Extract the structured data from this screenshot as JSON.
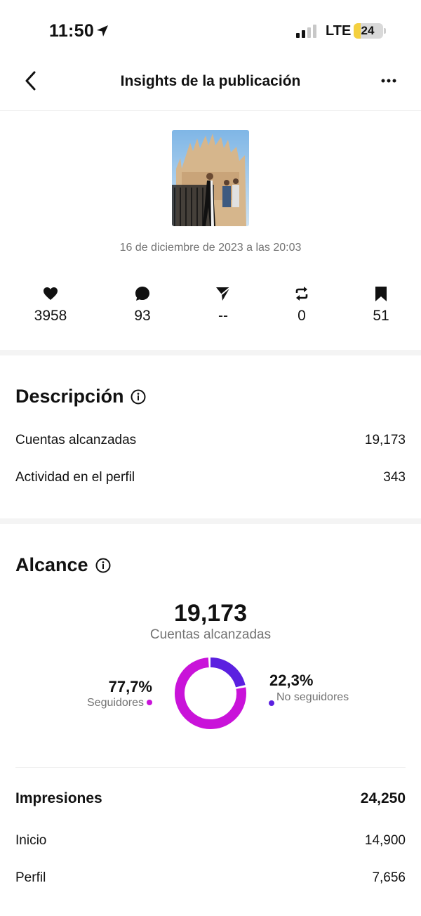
{
  "status_bar": {
    "time": "11:50",
    "network": "LTE",
    "battery": "24",
    "battery_level": 0.24
  },
  "header": {
    "title": "Insights de la publicación"
  },
  "post": {
    "date": "16 de diciembre de 2023 a las 20:03",
    "stats": {
      "likes": "3958",
      "comments": "93",
      "shares": "--",
      "reposts": "0",
      "saves": "51"
    }
  },
  "overview": {
    "title": "Descripción",
    "rows": [
      {
        "label": "Cuentas alcanzadas",
        "value": "19,173"
      },
      {
        "label": "Actividad en el perfil",
        "value": "343"
      }
    ]
  },
  "reach": {
    "title": "Alcance",
    "total": "19,173",
    "total_label": "Cuentas alcanzadas",
    "followers_pct": "77,7%",
    "followers_label": "Seguidores",
    "non_followers_pct": "22,3%",
    "non_followers_label": "No seguidores",
    "followers_fraction": 0.777,
    "colors": {
      "followers": "#c913d9",
      "non_followers": "#5b20e0"
    }
  },
  "impressions": {
    "title": "Impresiones",
    "total": "24,250",
    "rows": [
      {
        "label": "Inicio",
        "value": "14,900"
      },
      {
        "label": "Perfil",
        "value": "7,656"
      }
    ]
  }
}
